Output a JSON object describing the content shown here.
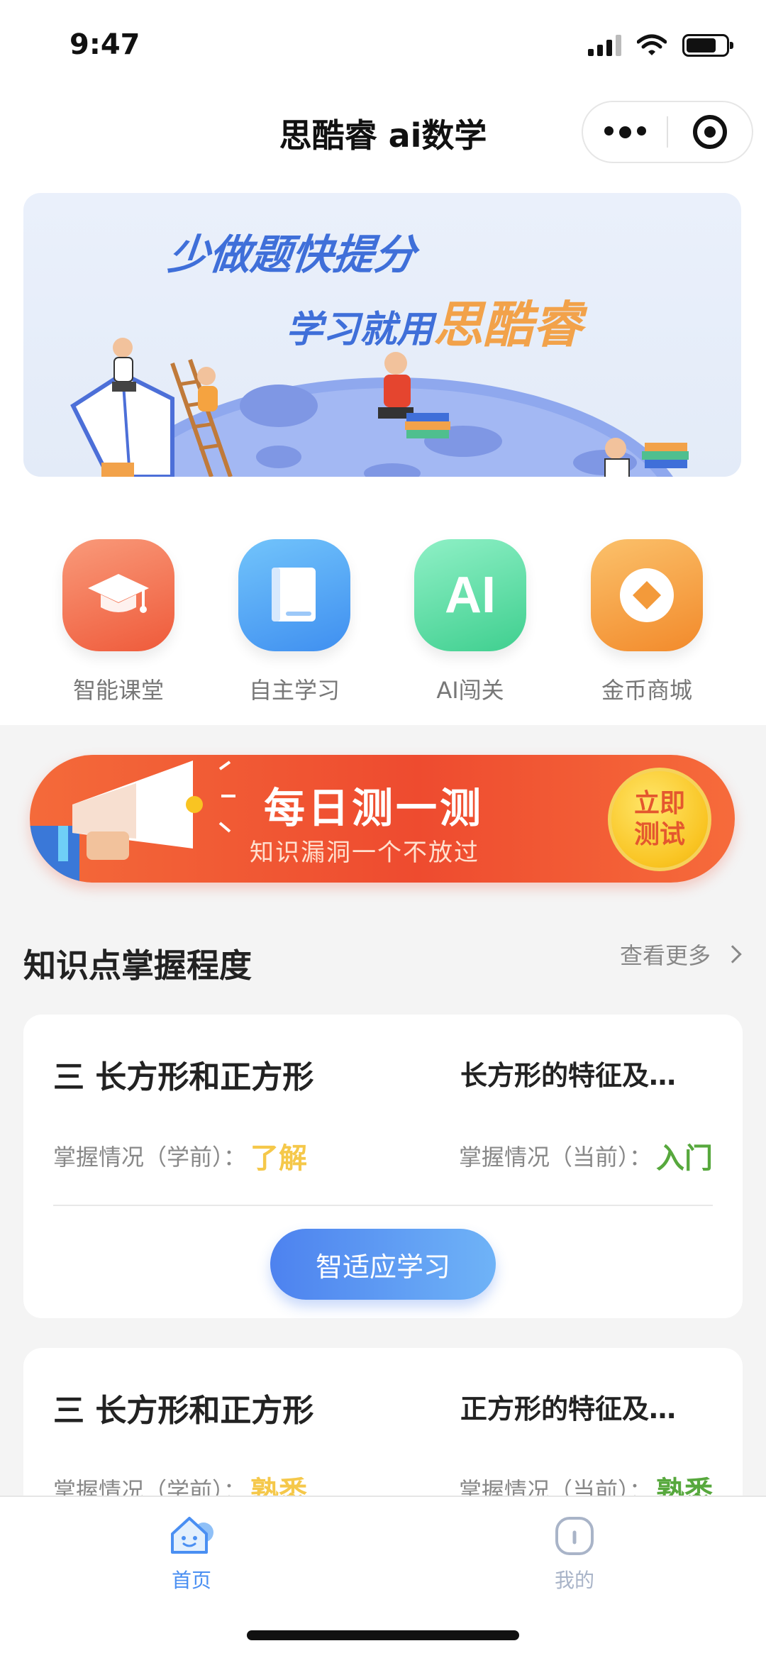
{
  "status_bar": {
    "time": "9:47"
  },
  "nav": {
    "title": "思酷睿 ai数学"
  },
  "banner": {
    "line1": "少做题快提分",
    "line2_prefix": "学习就用",
    "line2_brand": "思酷睿"
  },
  "menu": [
    {
      "label": "智能课堂",
      "icon": "graduation-cap-icon",
      "color": "#f06b47"
    },
    {
      "label": "自主学习",
      "icon": "book-icon",
      "color": "#4a9bf2"
    },
    {
      "label": "AI闯关",
      "icon": "ai-icon",
      "icon_text": "AI",
      "color": "#4fd39a"
    },
    {
      "label": "金币商城",
      "icon": "coin-icon",
      "color": "#f39a3a"
    }
  ],
  "daily_test": {
    "title": "每日测一测",
    "subtitle": "知识漏洞一个不放过",
    "button_line1": "立即",
    "button_line2": "测试"
  },
  "section": {
    "title": "知识点掌握程度",
    "more": "查看更多"
  },
  "cards": [
    {
      "chapter": "三 长方形和正方形",
      "point": "长方形的特征及…",
      "before_label": "掌握情况（学前）：",
      "before_level": "了解",
      "before_color": "#f5c84a",
      "current_label": "掌握情况（当前）：",
      "current_level": "入门",
      "current_color": "#57a83d",
      "button": "智适应学习"
    },
    {
      "chapter": "三 长方形和正方形",
      "point": "正方形的特征及…",
      "before_label": "掌握情况（学前）：",
      "before_level": "熟悉",
      "before_color": "#f5c84a",
      "current_label": "掌握情况（当前）：",
      "current_level": "熟悉",
      "current_color": "#57a83d"
    }
  ],
  "tabbar": [
    {
      "label": "首页",
      "icon": "home-icon",
      "active": true,
      "color": "#4a8ff2"
    },
    {
      "label": "我的",
      "icon": "profile-icon",
      "active": false,
      "color": "#a9b4c8"
    }
  ]
}
